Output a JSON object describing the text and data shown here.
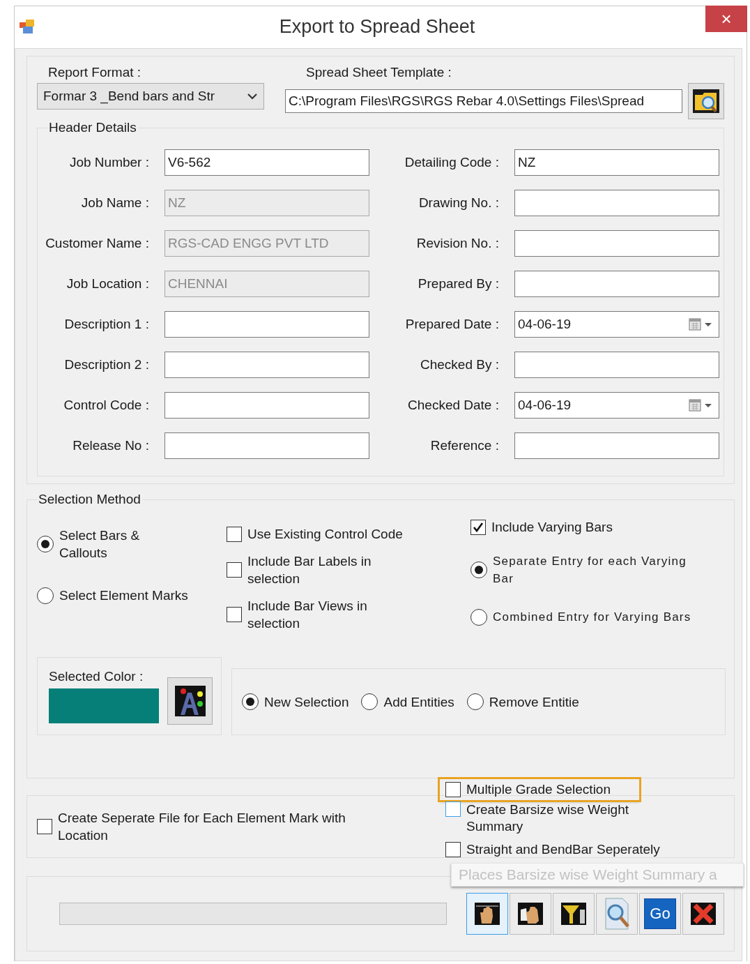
{
  "window": {
    "title": "Export to Spread Sheet",
    "close": "×"
  },
  "report_format": {
    "label": "Report Format :",
    "value": "Formar 3 _Bend bars and Str"
  },
  "template": {
    "label": "Spread Sheet Template :",
    "value": "C:\\Program Files\\RGS\\RGS Rebar 4.0\\Settings Files\\Spread"
  },
  "header_details": {
    "title": "Header Details",
    "left_fields": [
      {
        "label": "Job Number :",
        "value": "V6-562",
        "disabled": false,
        "kind": "text"
      },
      {
        "label": "Job Name :",
        "value": "NZ",
        "disabled": true,
        "kind": "text"
      },
      {
        "label": "Customer Name :",
        "value": "RGS-CAD ENGG PVT LTD",
        "disabled": true,
        "kind": "text"
      },
      {
        "label": "Job Location :",
        "value": "CHENNAI",
        "disabled": true,
        "kind": "text"
      },
      {
        "label": "Description 1 :",
        "disabled": false,
        "kind": "text"
      },
      {
        "label": "Description 2 :",
        "disabled": false,
        "kind": "text"
      },
      {
        "label": "Control Code :",
        "disabled": false,
        "kind": "text"
      },
      {
        "label": "Release No :",
        "disabled": false,
        "kind": "text"
      }
    ],
    "right_fields": [
      {
        "label": "Detailing Code :",
        "value": "NZ",
        "disabled": false,
        "kind": "text"
      },
      {
        "label": "Drawing No. :",
        "disabled": false,
        "kind": "text"
      },
      {
        "label": "Revision No. :",
        "disabled": false,
        "kind": "text"
      },
      {
        "label": "Prepared By :",
        "disabled": false,
        "kind": "text"
      },
      {
        "label": "Prepared Date :",
        "value": "04-06-19",
        "disabled": false,
        "kind": "date"
      },
      {
        "label": "Checked By :",
        "disabled": false,
        "kind": "text"
      },
      {
        "label": "Checked Date :",
        "value": "04-06-19",
        "disabled": false,
        "kind": "date"
      },
      {
        "label": "Reference :",
        "disabled": false,
        "kind": "text"
      }
    ]
  },
  "selection_method": {
    "title": "Selection Method",
    "methods": [
      {
        "label": "Select Bars & Callouts",
        "selected": true
      },
      {
        "label": "Select Element Marks",
        "selected": false
      }
    ],
    "options": [
      {
        "label": "Use Existing Control Code",
        "checked": false
      },
      {
        "label": "Include Bar Labels in selection",
        "checked": false
      },
      {
        "label": "Include Bar Views  in selection",
        "checked": false
      }
    ],
    "include_varying": {
      "label": "Include Varying Bars",
      "checked": true
    },
    "varying_modes": [
      {
        "label": "Separate Entry for each Varying Bar",
        "selected": true
      },
      {
        "label": "Combined Entry for Varying Bars",
        "selected": false
      }
    ],
    "selected_color": {
      "label": "Selected Color :",
      "color": "#067f79"
    },
    "selection_modes": [
      {
        "label": "New Selection",
        "selected": true
      },
      {
        "label": "Add Entities",
        "selected": false
      },
      {
        "label": "Remove Entitie",
        "selected": false
      }
    ]
  },
  "separate_file": {
    "label": "Create Seperate File for Each Element Mark with Location",
    "checked": false
  },
  "extra_options": [
    {
      "label": "Multiple Grade Selection",
      "checked": false,
      "highlighted": true,
      "hovered": false
    },
    {
      "label": "Create Barsize wise Weight Summary",
      "checked": false,
      "highlighted": false,
      "hovered": true
    },
    {
      "label": "Straight and BendBar Seperately",
      "checked": false,
      "highlighted": false,
      "hovered": false
    }
  ],
  "progress": {
    "level": 0
  },
  "tooltip": {
    "text": "Places Barsize wise Weight Summary a"
  },
  "toolbar": [
    {
      "kind": "hand",
      "selected": true
    },
    {
      "kind": "hands",
      "selected": false
    },
    {
      "kind": "filter",
      "selected": false
    },
    {
      "kind": "preview",
      "selected": false
    },
    {
      "kind": "go",
      "label": "Go",
      "selected": false
    },
    {
      "kind": "close",
      "selected": false
    }
  ]
}
